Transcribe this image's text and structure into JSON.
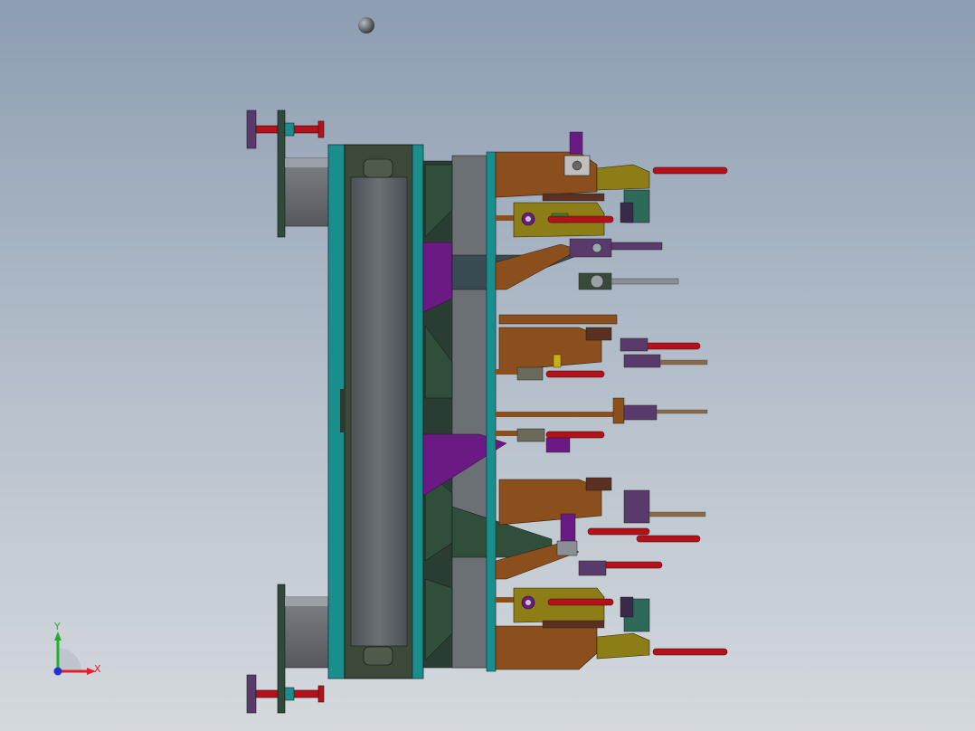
{
  "viewport": {
    "background_top": "#8d9db2",
    "background_bottom": "#d4d9dd"
  },
  "colors": {
    "clamp_handle": "#b3121b",
    "clamp_body": "#8d7d16",
    "bracket": "#8a4f1d",
    "rail": "#555a5e",
    "frame": "#3e4a40",
    "gusset": "#2f4f3a",
    "purple": "#6a1a82",
    "teal": "#1a8d8d",
    "grey_rod": "#8a8f94",
    "triad_x": "#e0202a",
    "triad_y": "#22b02a",
    "triad_z": "#2430d8"
  },
  "triad": {
    "x_label": "X",
    "y_label": "Y",
    "icon": "coordinate-triad-icon"
  }
}
